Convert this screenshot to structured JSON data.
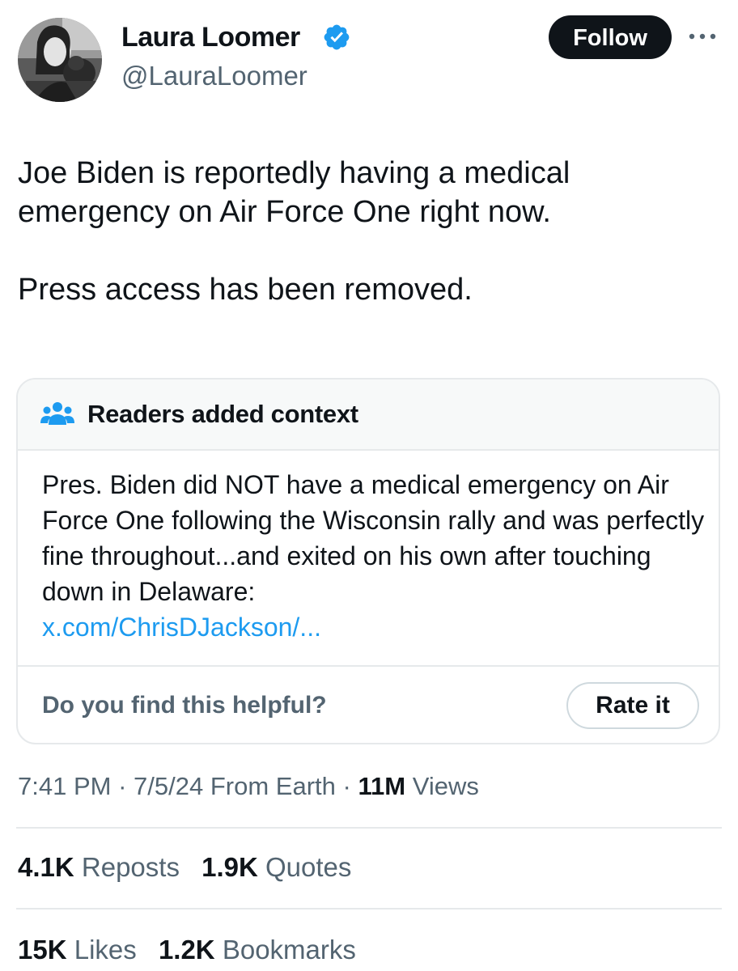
{
  "author": {
    "display_name": "Laura Loomer",
    "handle": "@LauraLoomer",
    "verified_icon": "verified-badge-icon",
    "verified_color": "#1d9bf0"
  },
  "header": {
    "follow_label": "Follow",
    "more_icon": "more-options-icon"
  },
  "tweet": {
    "paragraphs": [
      "Joe Biden is reportedly having a medical emergency on Air Force One right now.",
      "Press access has been removed."
    ]
  },
  "community_note": {
    "icon": "people-icon",
    "title": "Readers added context",
    "body": "Pres. Biden did NOT have a medical emergency on Air Force One following the Wisconsin rally and was perfectly fine throughout...and exited on his own after touching down in Delaware:",
    "link_text": "x.com/ChrisDJackson/...",
    "helpful_question": "Do you find this helpful?",
    "rate_label": "Rate it"
  },
  "meta": {
    "time": "7:41 PM",
    "separator": "·",
    "date": "7/5/24",
    "source": "From Earth",
    "views_count": "11M",
    "views_label": "Views"
  },
  "stats": {
    "reposts_count": "4.1K",
    "reposts_label": "Reposts",
    "quotes_count": "1.9K",
    "quotes_label": "Quotes",
    "likes_count": "15K",
    "likes_label": "Likes",
    "bookmarks_count": "1.2K",
    "bookmarks_label": "Bookmarks"
  },
  "colors": {
    "text": "#0f1419",
    "secondary": "#536471",
    "link": "#1d9bf0",
    "note_icon": "#1d9bf0",
    "border": "#e6e9eb"
  }
}
